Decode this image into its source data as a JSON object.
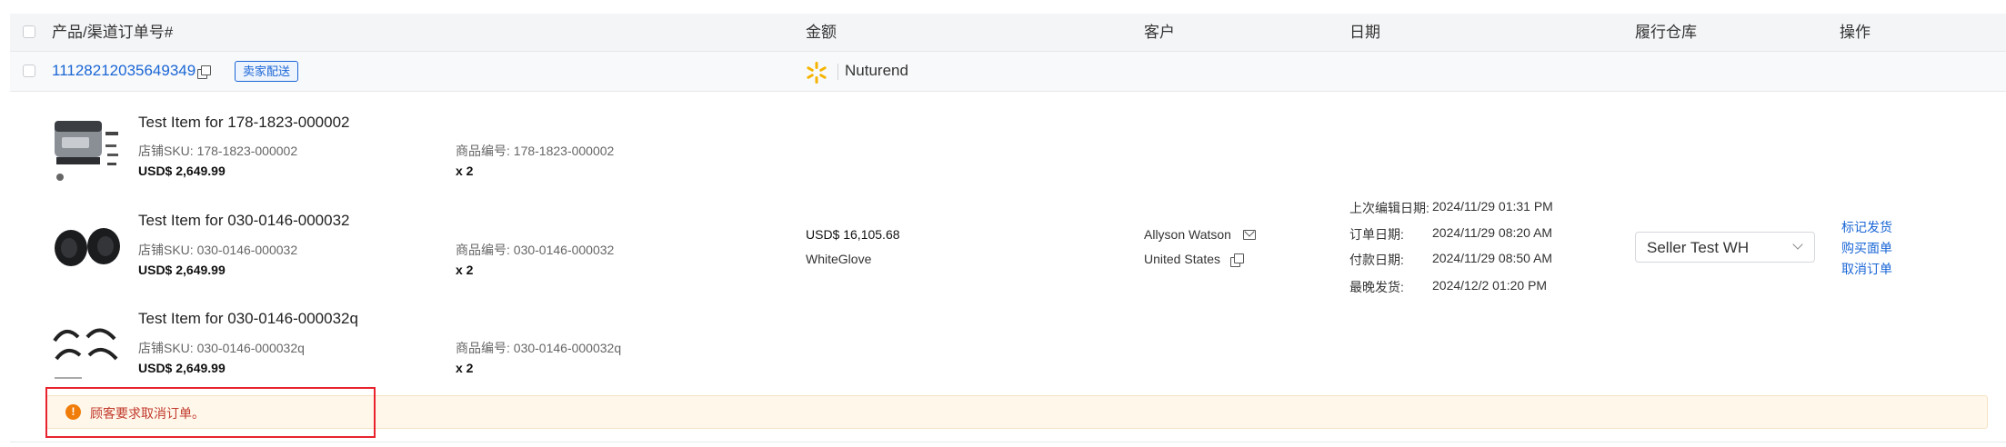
{
  "table": {
    "headers": {
      "product": "产品/渠道订单号#",
      "amount": "金额",
      "customer": "客户",
      "date": "日期",
      "warehouse": "履行仓库",
      "actions": "操作"
    }
  },
  "order": {
    "order_no": "111282120356493­49",
    "tag": "卖家配送",
    "channel_name": "Nuturend",
    "items": [
      {
        "title": "Test Item for 178-1823-000002",
        "store_sku": "店铺SKU: 178-1823-000002",
        "price": "USD$ 2,649.99",
        "product_no": "商品编号: 178-1823-000002",
        "qty": "x 2"
      },
      {
        "title": "Test Item for 030-0146-000032",
        "store_sku": "店铺SKU: 030-0146-000032",
        "price": "USD$ 2,649.99",
        "product_no": "商品编号: 030-0146-000032",
        "qty": "x 2"
      },
      {
        "title": "Test Item for 030-0146-000032q",
        "store_sku": "店铺SKU: 030-0146-000032q",
        "price": "USD$ 2,649.99",
        "product_no": "商品编号: 030-0146-000032q",
        "qty": "x 2"
      }
    ],
    "amount": "USD$ 16,105.68",
    "shipping_method": "WhiteGlove",
    "customer_name": "Allyson Watson",
    "customer_country": "United States",
    "dates": [
      {
        "label": "上次编辑日期:",
        "value": "2024/11/29 01:31 PM"
      },
      {
        "label": "订单日期:",
        "value": "2024/11/29 08:20 AM"
      },
      {
        "label": "付款日期:",
        "value": "2024/11/29 08:50 AM"
      },
      {
        "label": "最晚发货:",
        "value": "2024/12/2 01:20 PM"
      }
    ],
    "warehouse": "Seller Test WH",
    "actions": [
      "标记发货",
      "购买面单",
      "取消订单"
    ],
    "alert": "顾客要求取消订单。"
  },
  "colors": {
    "link": "#1a66d6",
    "alert_bg": "#fff7ea",
    "alert_icon": "#f07d0a",
    "alert_text": "#c0392b",
    "highlight_box": "#e8232e",
    "walmart_spark": "#f5b400"
  },
  "icons": {
    "copy": "copy-icon",
    "walmart": "walmart-spark-icon",
    "mail": "mail-icon",
    "alert": "exclamation-circle-icon",
    "dropdown": "chevron-down-icon"
  }
}
